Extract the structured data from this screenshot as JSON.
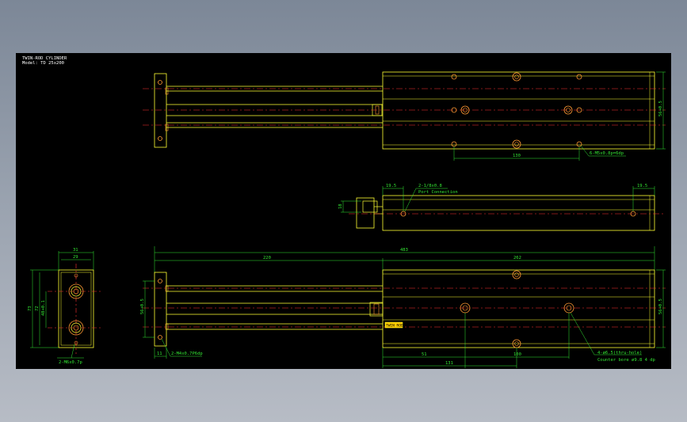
{
  "title_block": {
    "line1": "TWIN-ROD CYLINDER",
    "line2": "Model: TD 25x200"
  },
  "top_view": {
    "dim_hole_pitch": "130",
    "dim_height": "56+0.5",
    "callout_holes": "6-M5x0.8p=6dp"
  },
  "side_view": {
    "dim_left_offset": "19.5",
    "dim_right_offset": "19.5",
    "port_callout": "2-1/8x0.8",
    "port_note": "Port Connection",
    "dim_rod_height": "18"
  },
  "end_view": {
    "dim_width_outer": "31",
    "dim_width_inner": "29",
    "dim_height_outer": "73",
    "dim_height_inner": "72",
    "dim_rod_pitch": "48+0.1",
    "callout": "2-M6x0.7p"
  },
  "front_view": {
    "dim_total": "483",
    "dim_rod_length": "220",
    "dim_body_length": "262",
    "dim_plate": "11",
    "dim_left_height": "56+0.5",
    "dim_right_height": "56+0.5",
    "dim_51": "51",
    "dim_131": "131",
    "dim_100": "100",
    "callout_plate": "2-M4x0.7P6dp",
    "callout_cbore": "4-ø6.5(thru-hole)",
    "callout_cbore_note": "Counter bore ø9.8 4 dp",
    "label": "TWIN ROD"
  }
}
